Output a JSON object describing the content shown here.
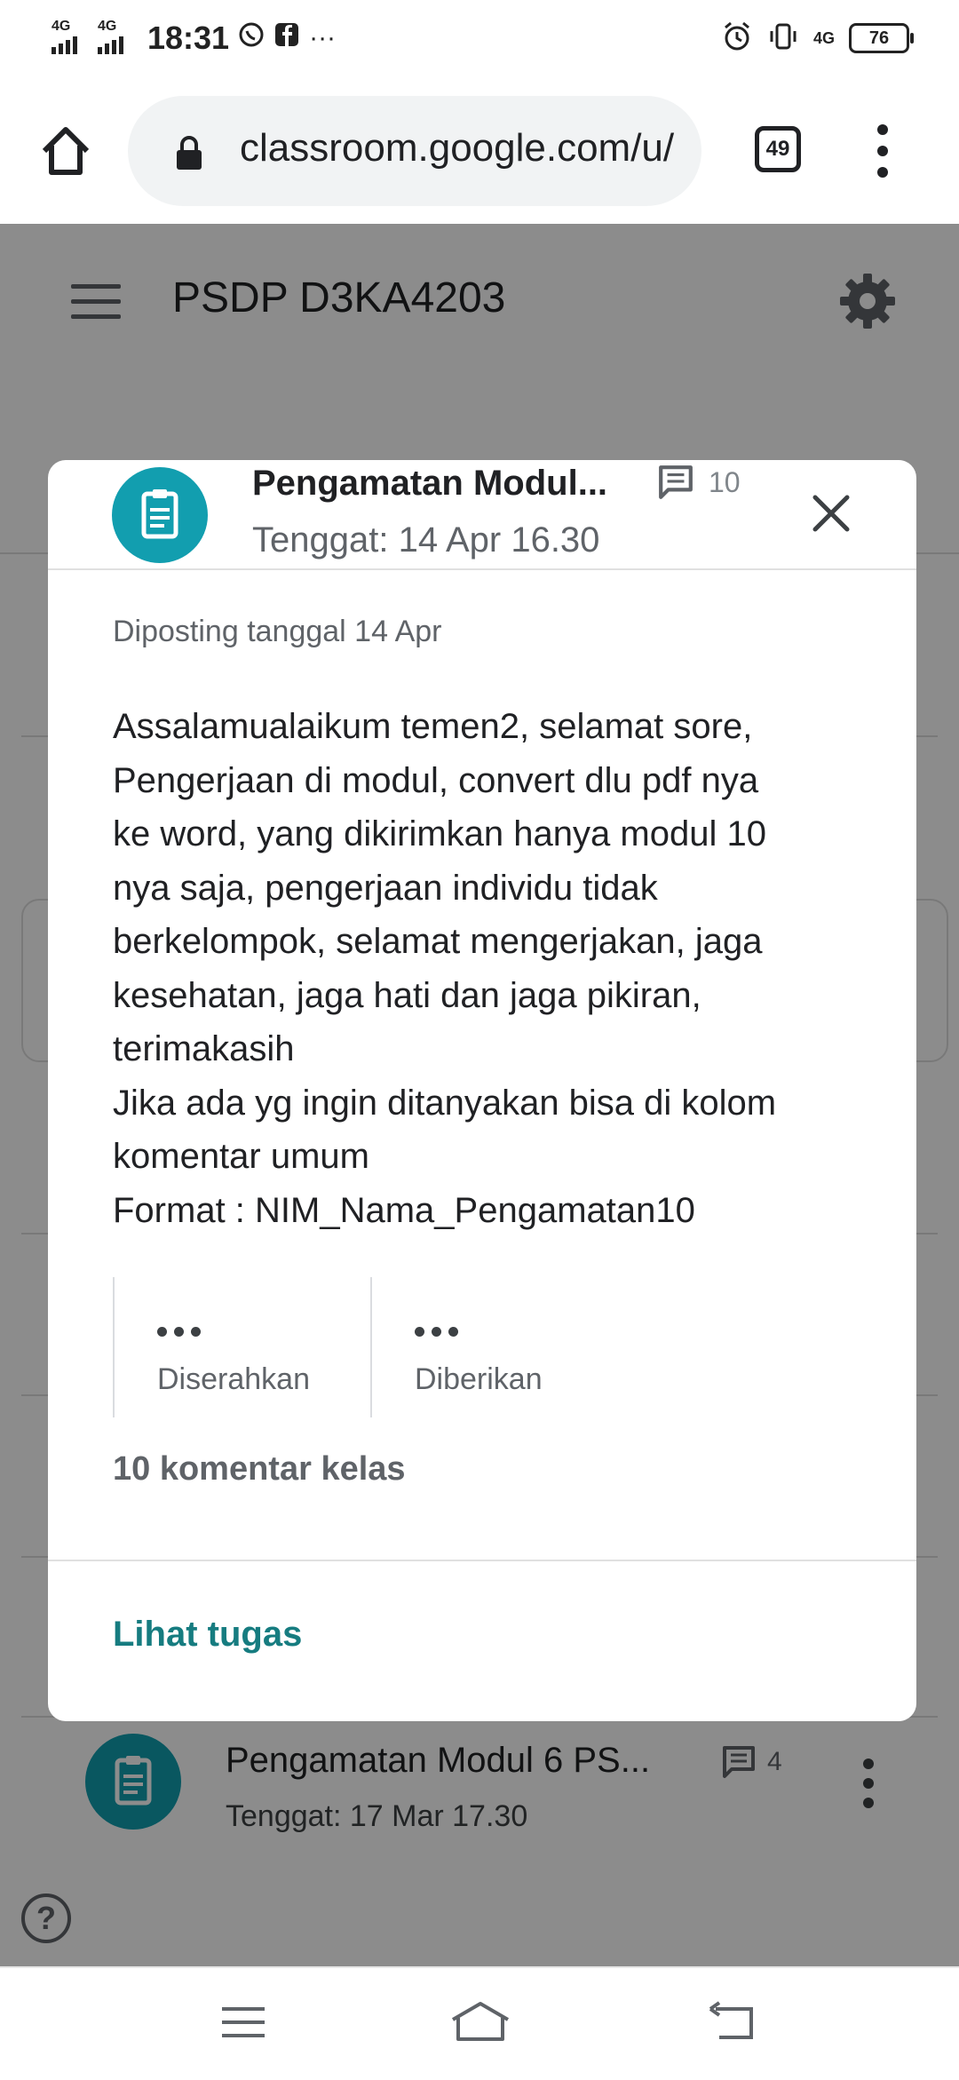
{
  "status_bar": {
    "net1": "4G",
    "net2": "4G",
    "time": "18:31",
    "more": "···",
    "net3": "4G",
    "battery": "76"
  },
  "browser": {
    "url": "classroom.google.com/u/",
    "tab_count": "49"
  },
  "classroom": {
    "class_title": "PSDP D3KA4203",
    "background_item": {
      "title": "Pengamatan Modul 6 PS...",
      "comment_count": "4",
      "due": "Tenggat: 17 Mar 17.30"
    }
  },
  "dialog": {
    "title": "Pengamatan Modul...",
    "comment_count": "10",
    "due": "Tenggat: 14 Apr 16.30",
    "posted": "Diposting tanggal 14 Apr",
    "body": "Assalamualaikum temen2, selamat sore,\nPengerjaan di modul, convert dlu pdf nya\nke word, yang dikirimkan hanya modul 10\nnya saja, pengerjaan individu tidak\nberkelompok, selamat mengerjakan, jaga\nkesehatan, jaga hati dan jaga pikiran,\nterimakasih\nJika ada yg ingin ditanyakan bisa di kolom\nkomentar umum\nFormat : NIM_Nama_Pengamatan10",
    "stat_submitted_label": "Diserahkan",
    "stat_assigned_label": "Diberikan",
    "class_comments": "10 komentar kelas",
    "view_task": "Lihat tugas"
  },
  "colors": {
    "accent_teal": "#129eaf",
    "link_teal": "#167c80",
    "scrim": "rgba(0,0,0,0.45)"
  },
  "icons": [
    "home-icon",
    "lock-icon",
    "tabs-icon",
    "more-vert-icon",
    "menu-icon",
    "settings-icon",
    "assignment-icon",
    "comment-icon",
    "close-icon",
    "help-icon"
  ]
}
